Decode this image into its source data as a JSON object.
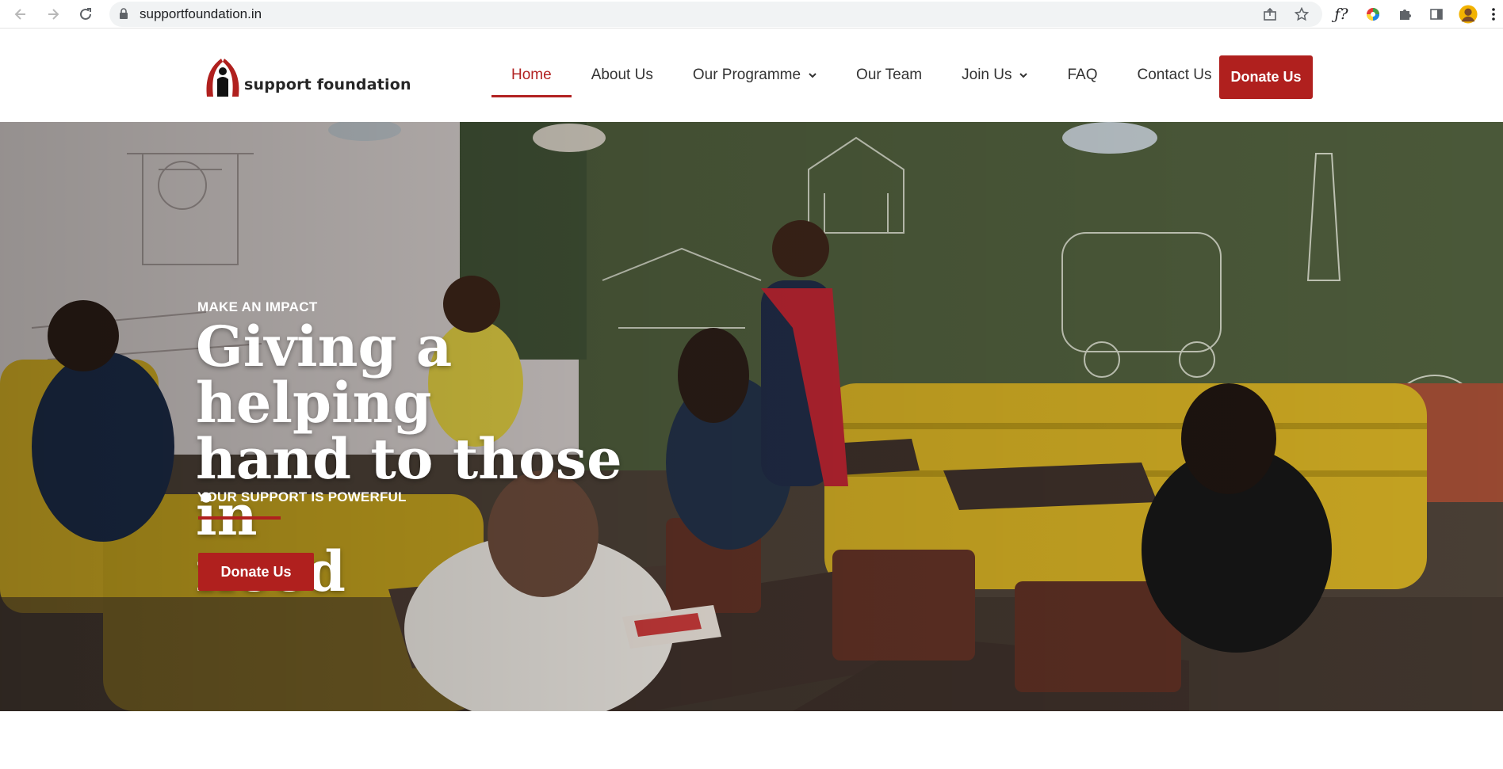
{
  "browser": {
    "url": "supportfoundation.in"
  },
  "site": {
    "logo_text": "support foundation"
  },
  "nav": {
    "items": [
      {
        "label": "Home",
        "active": true,
        "dropdown": false
      },
      {
        "label": "About Us",
        "active": false,
        "dropdown": false
      },
      {
        "label": "Our Programme",
        "active": false,
        "dropdown": true
      },
      {
        "label": "Our Team",
        "active": false,
        "dropdown": false
      },
      {
        "label": "Join Us",
        "active": false,
        "dropdown": true
      },
      {
        "label": "FAQ",
        "active": false,
        "dropdown": false
      },
      {
        "label": "Contact Us",
        "active": false,
        "dropdown": false
      }
    ],
    "donate_label": "Donate Us"
  },
  "hero": {
    "eyebrow": "MAKE AN IMPACT",
    "headline_line1": "Giving a helping",
    "headline_line2": "hand to those in",
    "headline_line3": "need",
    "subline": "YOUR SUPPORT IS POWERFUL",
    "donate_label": "Donate Us"
  },
  "colors": {
    "brand_red": "#b0201e",
    "active_nav": "#b22222"
  }
}
